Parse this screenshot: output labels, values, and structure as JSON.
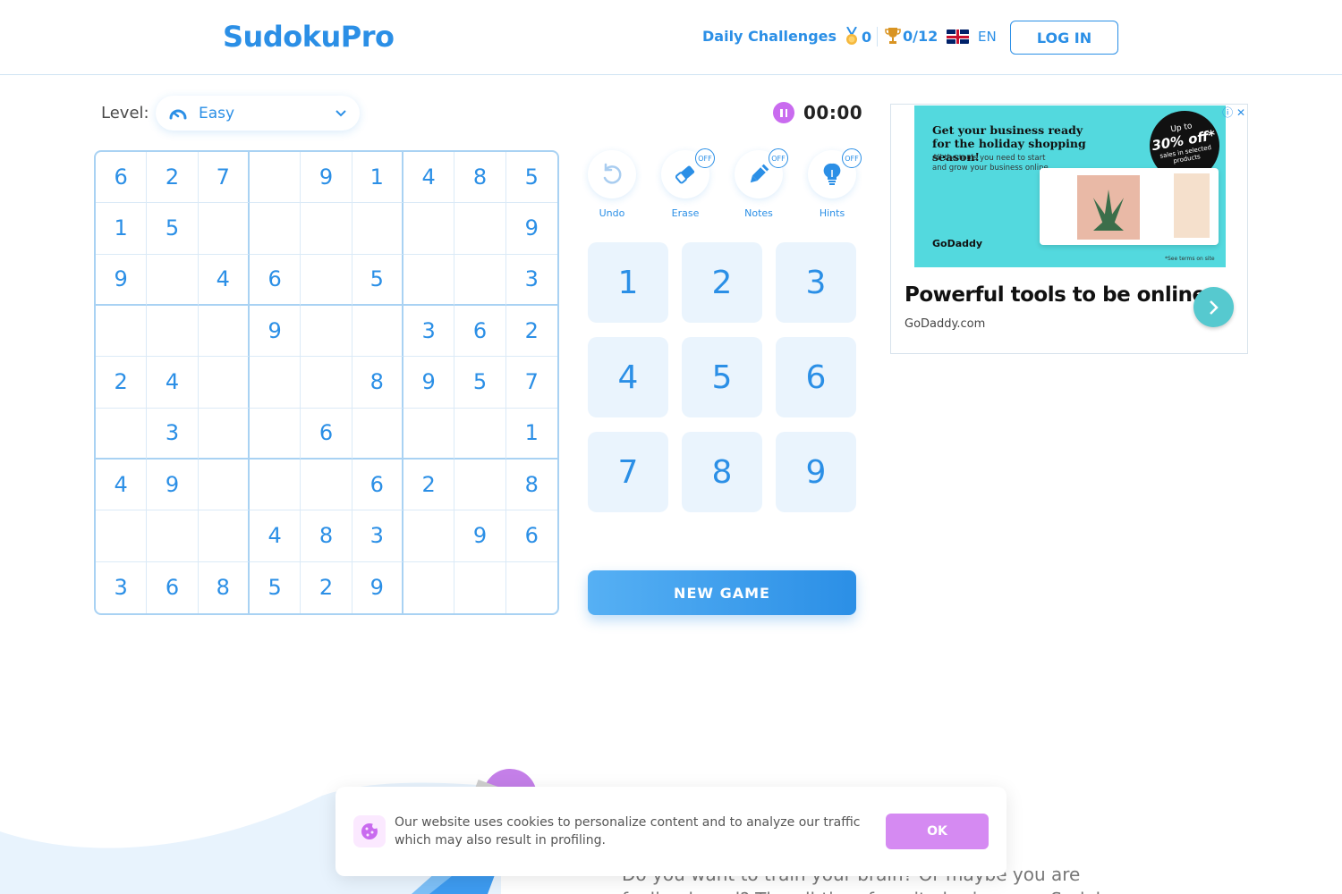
{
  "header": {
    "logo": "SudokuPro",
    "daily_challenges": "Daily Challenges",
    "medals": "0",
    "trophies": "0/12",
    "language": "EN",
    "login": "LOG IN"
  },
  "level": {
    "label": "Level:",
    "value": "Easy"
  },
  "timer": "00:00",
  "board": [
    [
      "6",
      "2",
      "7",
      "",
      "9",
      "1",
      "4",
      "8",
      "5"
    ],
    [
      "1",
      "5",
      "",
      "",
      "",
      "",
      "",
      "",
      "9"
    ],
    [
      "9",
      "",
      "4",
      "6",
      "",
      "5",
      "",
      "",
      "3"
    ],
    [
      "",
      "",
      "",
      "9",
      "",
      "",
      "3",
      "6",
      "2"
    ],
    [
      "2",
      "4",
      "",
      "",
      "",
      "8",
      "9",
      "5",
      "7"
    ],
    [
      "",
      "3",
      "",
      "",
      "6",
      "",
      "",
      "",
      "1"
    ],
    [
      "4",
      "9",
      "",
      "",
      "",
      "6",
      "2",
      "",
      "8"
    ],
    [
      "",
      "",
      "",
      "4",
      "8",
      "3",
      "",
      "9",
      "6"
    ],
    [
      "3",
      "6",
      "8",
      "5",
      "2",
      "9",
      "",
      "",
      ""
    ]
  ],
  "tools": {
    "undo": "Undo",
    "erase": "Erase",
    "notes": "Notes",
    "hints": "Hints",
    "off": "OFF"
  },
  "numpad": [
    "1",
    "2",
    "3",
    "4",
    "5",
    "6",
    "7",
    "8",
    "9"
  ],
  "new_game": "NEW GAME",
  "ad": {
    "banner_headline": "Get your business ready for the holiday shopping season!",
    "banner_sub": "All the tools you need to start and grow your business online",
    "promo_top": "Up to",
    "promo_big": "30% off*",
    "promo_bottom": "sales in selected products",
    "brand": "GoDaddy",
    "terms": "*See terms on site",
    "title": "Powerful tools to be online",
    "domain": "GoDaddy.com"
  },
  "bottom_text": "Do you want to train your brain? Or maybe you are feeling bored? The all-time favorite brain game Sudoku can",
  "cookie": {
    "text": "Our website uses cookies to personalize content and to analyze our traffic which may also result in profiling.",
    "ok": "OK"
  },
  "colors": {
    "primary": "#2b8fe6",
    "accent_purple": "#c96bef",
    "cell_bg": "#eaf4fd"
  }
}
